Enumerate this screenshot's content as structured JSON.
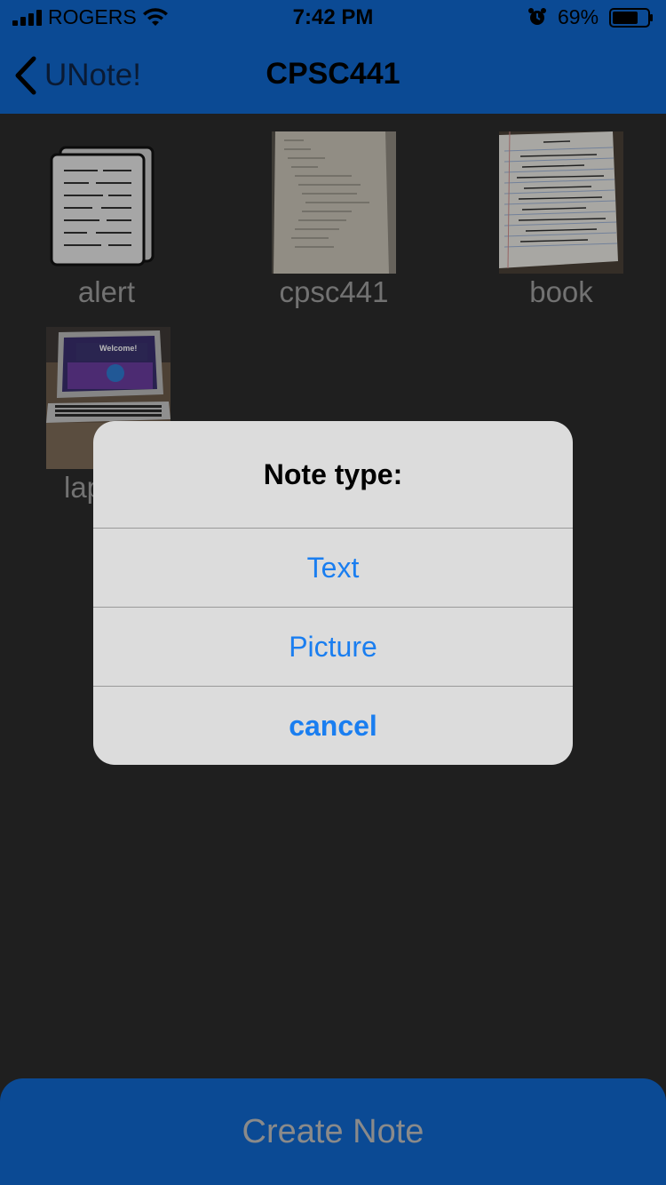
{
  "status_bar": {
    "carrier": "ROGERS",
    "time": "7:42 PM",
    "battery_percent": "69%"
  },
  "nav": {
    "back_label": "UNote!",
    "title": "CPSC441"
  },
  "notes": [
    {
      "name": "alert",
      "thumbnail": "text-note-icon"
    },
    {
      "name": "cpsc441",
      "thumbnail": "notebook-photo"
    },
    {
      "name": "book",
      "thumbnail": "lined-paper-photo"
    },
    {
      "name": "lap",
      "thumbnail": "laptop-photo"
    }
  ],
  "laptop_screen_text": "Welcome!",
  "dialog": {
    "title": "Note type:",
    "buttons": [
      "Text",
      "Picture",
      "cancel"
    ]
  },
  "create_button": "Create Note",
  "colors": {
    "nav_bar": "#0b4a94",
    "background": "#2b2b2b",
    "dialog_bg": "#dcdcdc",
    "dialog_link": "#1a7ef0"
  }
}
